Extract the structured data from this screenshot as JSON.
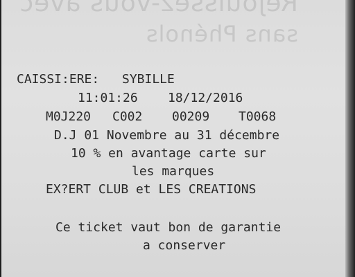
{
  "ghost_text": {
    "line1": "Réjouissez-vous avec",
    "line2": "sans Phénols"
  },
  "receipt": {
    "cashier_label": "CAISSI:ERE:",
    "cashier_name": "SYBILLE",
    "time": "11:01:26",
    "date": "18/12/2016",
    "codes": [
      "M0J220",
      "C002",
      "00209",
      "T0068"
    ],
    "promo_line1": "D.J 01 Novembre au 31 décembre",
    "promo_line2": "10 % en avantage carte sur",
    "promo_line3": "les marques",
    "promo_line4": "EX?ERT CLUB et LES CREATIONS",
    "warranty_line1": "Ce ticket vaut bon de garantie",
    "warranty_line2": "a conserver"
  }
}
